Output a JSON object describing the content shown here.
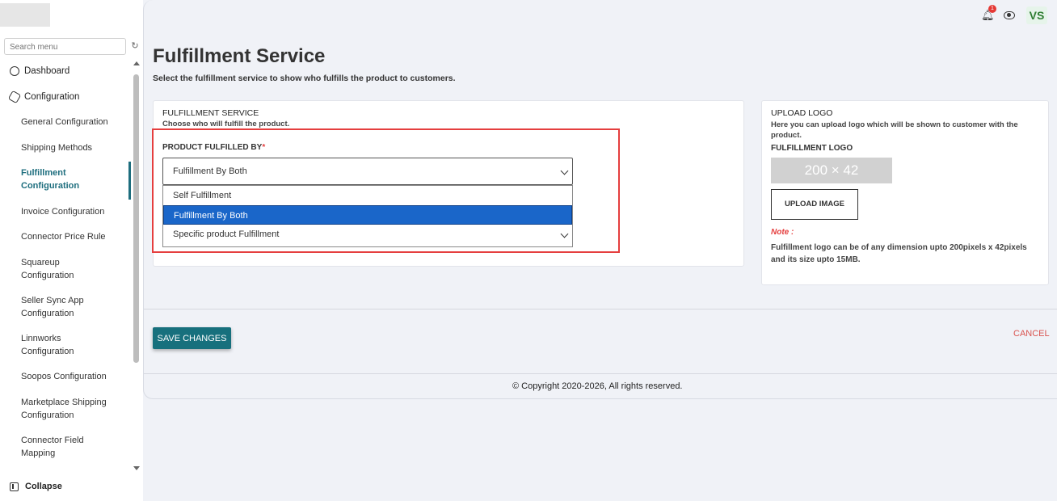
{
  "sidebar": {
    "search_placeholder": "Search menu",
    "items": [
      {
        "label": "Dashboard",
        "type": "top"
      },
      {
        "label": "Configuration",
        "type": "top"
      },
      {
        "label": "General Configuration",
        "type": "sub"
      },
      {
        "label": "Shipping Methods",
        "type": "sub"
      },
      {
        "label": "Fulfillment Configuration",
        "type": "sub",
        "active": true
      },
      {
        "label": "Invoice Configuration",
        "type": "sub"
      },
      {
        "label": "Connector Price Rule",
        "type": "sub"
      },
      {
        "label": "Squareup Configuration",
        "type": "sub"
      },
      {
        "label": "Seller Sync App Configuration",
        "type": "sub"
      },
      {
        "label": "Linnworks Configuration",
        "type": "sub"
      },
      {
        "label": "Soopos Configuration",
        "type": "sub"
      },
      {
        "label": "Marketplace Shipping Configuration",
        "type": "sub"
      },
      {
        "label": "Connector Field Mapping",
        "type": "sub"
      }
    ],
    "collapse_label": "Collapse"
  },
  "header": {
    "notification_count": "1",
    "avatar_initials": "VS"
  },
  "page": {
    "title": "Fulfillment Service",
    "subtitle": "Select the fulfillment service to show who fulfills the product to customers."
  },
  "fulfillment_card": {
    "title": "FULFILLMENT SERVICE",
    "subtitle": "Choose who will fulfill the product.",
    "field_label": "PRODUCT FULFILLED BY",
    "required_mark": "*",
    "selected_value": "Fulfillment By Both",
    "options": [
      "Self Fulfillment",
      "Fulfillment By Both",
      "Specific product Fulfillment"
    ]
  },
  "logo_card": {
    "title": "UPLOAD LOGO",
    "description": "Here you can upload logo which will be shown to customer with the product.",
    "logo_label": "FULFILLMENT LOGO",
    "placeholder_size": "200 × 42",
    "upload_button": "UPLOAD IMAGE",
    "note_label": "Note :",
    "note_text": "Fulfillment logo can be of any dimension upto 200pixels x 42pixels and its size upto 15MB."
  },
  "actions": {
    "save_label": "SAVE CHANGES",
    "cancel_label": "CANCEL"
  },
  "footer": {
    "copyright": "© Copyright 2020-2026, All rights reserved."
  },
  "colors": {
    "accent": "#17707d",
    "danger": "#e53e3e",
    "selected_option": "#1a66c9"
  }
}
